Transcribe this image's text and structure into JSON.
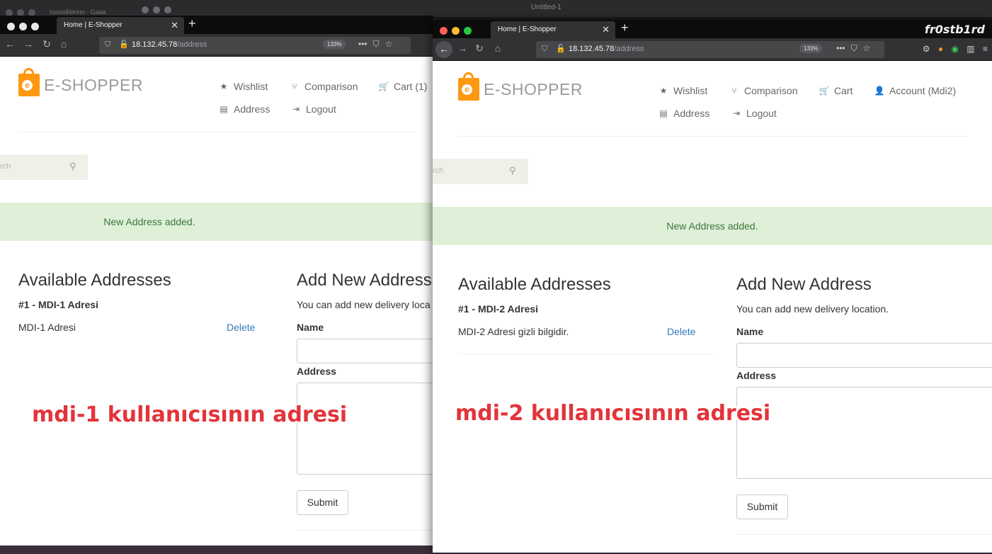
{
  "background_window": {
    "title": "Untitled-1",
    "old_tab": "ssssslliiiinnn - Gaaa"
  },
  "window_left": {
    "tab": {
      "title": "Home | E-Shopper",
      "close": "✕",
      "new_tab": "+"
    },
    "url_host": "18.132.45.78",
    "url_path": "/address",
    "zoom": "133%",
    "logo_text": "E-SHOPPER",
    "menu": {
      "wishlist": "Wishlist",
      "comparison": "Comparison",
      "cart": "Cart (1)",
      "address": "Address",
      "logout": "Logout"
    },
    "search_placeholder": "rch",
    "alert": "New Address added.",
    "available_title": "Available Addresses",
    "address_heading": "#1 - MDI-1 Adresi",
    "address_text": "MDI-1 Adresi",
    "delete_label": "Delete",
    "add_title": "Add New Address",
    "add_subtitle": "You can add new delivery loca",
    "name_label": "Name",
    "address_label": "Address",
    "submit_label": "Submit",
    "caption": "mdi-1 kullanıcısının adresi"
  },
  "window_right": {
    "tab": {
      "title": "Home | E-Shopper",
      "close": "✕",
      "new_tab": "+"
    },
    "watermark": "fr0stb1rd",
    "url_host": "18.132.45.78",
    "url_path": "/address",
    "zoom": "133%",
    "logo_text": "E-SHOPPER",
    "menu": {
      "wishlist": "Wishlist",
      "comparison": "Comparison",
      "cart": "Cart",
      "account": "Account (Mdi2)",
      "address": "Address",
      "logout": "Logout"
    },
    "search_placeholder": "rch",
    "alert": "New Address added.",
    "available_title": "Available Addresses",
    "address_heading": "#1 - MDI-2 Adresi",
    "address_text": "MDI-2 Adresi gizli bilgidir.",
    "delete_label": "Delete",
    "add_title": "Add New Address",
    "add_subtitle": "You can add new delivery location.",
    "name_label": "Name",
    "address_label": "Address",
    "submit_label": "Submit",
    "caption": "mdi-2 kullanıcısının adresi"
  },
  "icons": {
    "star": "★",
    "compare": "⑂",
    "cart": "🛒",
    "book": "▤",
    "logout": "⇥",
    "user": "👤",
    "back": "←",
    "forward": "→",
    "reload": "↻",
    "home": "⌂",
    "search": "⚲"
  },
  "colors": {
    "accent_orange": "#fe980f",
    "alert_bg": "#dff0d8",
    "alert_text": "#3c763d",
    "link": "#337ab7",
    "caption_red": "#e2343a"
  }
}
